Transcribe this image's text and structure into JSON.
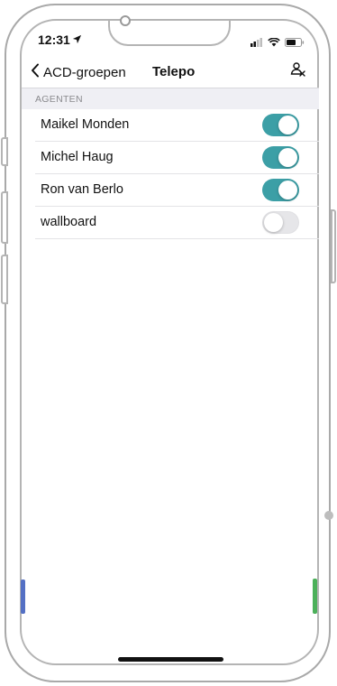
{
  "status_bar": {
    "time": "12:31"
  },
  "nav": {
    "back_label": "ACD-groepen",
    "title": "Telepo",
    "action_icon": "agent-config-icon"
  },
  "section": {
    "header": "AGENTEN"
  },
  "agents": [
    {
      "name": "Maikel Monden",
      "enabled": true
    },
    {
      "name": "Michel Haug",
      "enabled": true
    },
    {
      "name": "Ron van Berlo",
      "enabled": true
    },
    {
      "name": "wallboard",
      "enabled": false
    }
  ],
  "colors": {
    "toggle_on": "#3c9fa6",
    "toggle_off": "#e6e6e9"
  }
}
